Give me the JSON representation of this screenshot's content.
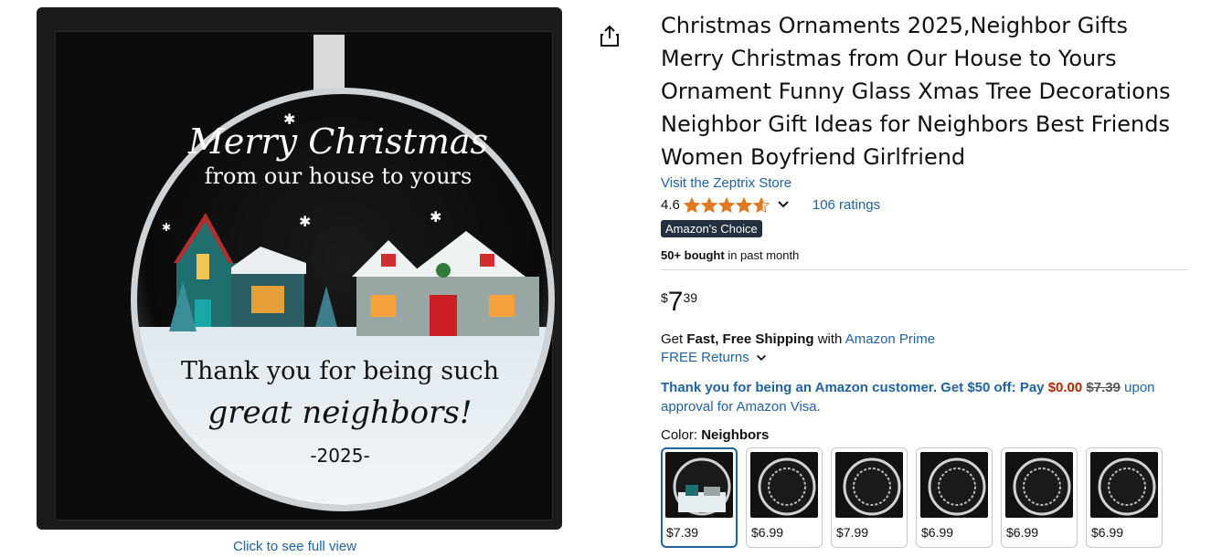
{
  "image": {
    "ornament_lines": [
      "Merry Christmas",
      "from our house to yours",
      "Thank  you for being such",
      "great neighbors!",
      "-2025-"
    ],
    "full_view_label": "Click to see full view"
  },
  "product": {
    "title": "Christmas Ornaments 2025,Neighbor Gifts Merry Christmas from Our House to Yours Ornament Funny Glass Xmas Tree Decorations Neighbor Gift Ideas for Neighbors Best Friends Women Boyfriend Girlfriend",
    "store_link": "Visit the Zeptrix Store",
    "rating": "4.6",
    "rating_value": 4.6,
    "ratings_count": "106 ratings",
    "badge": "Amazon's Choice",
    "bought_bold": "50+ bought",
    "bought_rest": " in past month",
    "price": {
      "symbol": "$",
      "whole": "7",
      "fraction": "39"
    },
    "shipping": {
      "prefix": "Get ",
      "bold": "Fast, Free Shipping",
      "middle": " with ",
      "link": "Amazon Prime"
    },
    "returns": "FREE Returns",
    "promo": {
      "text1": "Thank you for being an Amazon customer. Get $50 off: Pay ",
      "pay": "$0.00",
      "strike": "$7.39",
      "text2": " upon approval for Amazon Visa."
    },
    "color_label": "Color: ",
    "color_value": "Neighbors",
    "swatches": [
      {
        "price": "$7.39",
        "selected": true
      },
      {
        "price": "$6.99",
        "selected": false
      },
      {
        "price": "$7.99",
        "selected": false
      },
      {
        "price": "$6.99",
        "selected": false
      },
      {
        "price": "$6.99",
        "selected": false
      },
      {
        "price": "$6.99",
        "selected": false
      }
    ]
  },
  "colors": {
    "link": "#2162a1",
    "star": "#de7921",
    "badge_bg": "#232f3e",
    "price_red": "#b12704"
  },
  "icons": [
    "share-icon",
    "star-icon",
    "chevron-down-icon"
  ]
}
